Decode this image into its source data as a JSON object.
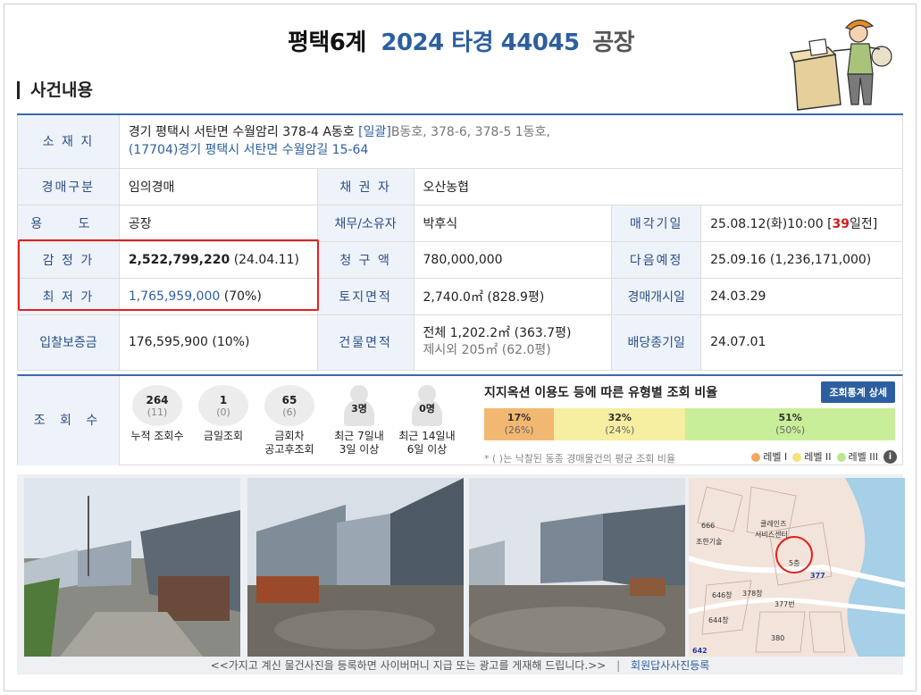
{
  "header": {
    "court": "평택6계",
    "case_no": "2024 타경 44045",
    "kind": "공장"
  },
  "section_title": "사건내용",
  "info": {
    "location_label": "소 재 지",
    "location_line1_a": "경기 평택시 서탄면 수월암리 378-4 A동호",
    "location_line1_b": "[일괄]",
    "location_line1_c": "B동호, 378-6, 378-5 1동호,",
    "location_line2_a": "(17704)경기 평택시 서탄면 수월암길 15-64",
    "auction_type_label": "경매구분",
    "auction_type": "임의경매",
    "creditor_label": "채 권 자",
    "creditor": "오산농협",
    "usage_label": "용 도",
    "usage": "공장",
    "owner_label": "채무/소유자",
    "owner": "박후식",
    "sale_date_label": "매각기일",
    "sale_date_a": "25.08.12(화)10:00 [",
    "sale_date_days": "39",
    "sale_date_b": "일전]",
    "appraisal_label": "감 정 가",
    "appraisal_value": "2,522,799,220",
    "appraisal_date": "(24.04.11)",
    "claim_label": "청 구 액",
    "claim": "780,000,000",
    "next_label": "다음예정",
    "next": "25.09.16 (1,236,171,000)",
    "min_label": "최 저 가",
    "min_value": "1,765,959,000",
    "min_pct": "(70%)",
    "land_label": "토지면적",
    "land": "2,740.0㎡ (828.9평)",
    "start_label": "경매개시일",
    "start": "24.03.29",
    "deposit_label": "입찰보증금",
    "deposit": "176,595,900 (10%)",
    "building_label": "건물면적",
    "building_line1": "전체 1,202.2㎡ (363.7평)",
    "building_line2": "제시외 205㎡ (62.0평)",
    "dividend_label": "배당종기일",
    "dividend": "24.07.01"
  },
  "views": {
    "label": "조 회 수",
    "stats": [
      {
        "n": "264",
        "s": "(11)",
        "cap1": "누적 조회수",
        "cap2": ""
      },
      {
        "n": "1",
        "s": "(0)",
        "cap1": "금일조회",
        "cap2": ""
      },
      {
        "n": "65",
        "s": "(6)",
        "cap1": "금회차",
        "cap2": "공고후조회"
      },
      {
        "n": "3명",
        "s": "",
        "cap1": "최근 7일내",
        "cap2": "3일 이상"
      },
      {
        "n": "0명",
        "s": "",
        "cap1": "최근 14일내",
        "cap2": "6일 이상"
      }
    ],
    "ratio_title": "지지옥션 이용도 등에 따른 유형별 조회 비율",
    "ratio_button": "조회통계 상세",
    "segments": [
      {
        "p": "17%",
        "q": "(26%)",
        "color": "#f2b872",
        "fraction": 0.17
      },
      {
        "p": "32%",
        "q": "(24%)",
        "color": "#f6eea0",
        "fraction": 0.32
      },
      {
        "p": "51%",
        "q": "(50%)",
        "color": "#c9ee9a",
        "fraction": 0.51
      }
    ],
    "note": "* ( )는 낙찰된 동종 경매물건의 평균 조회 비율",
    "legend": [
      "레벨 I",
      "레벨 II",
      "레벨 III"
    ],
    "legend_colors": [
      "#f2a95e",
      "#f6e27a",
      "#b8e88a"
    ],
    "info_icon": "i"
  },
  "footer": {
    "text": "<<가지고 계신 물건사진을 등록하면 사이버머니 지급 또는 광고를 게재해 드립니다.>>",
    "sep": "|",
    "link": "회원답사사진등록"
  },
  "map_labels": [
    "666",
    "클레인즈",
    "서비스센터",
    "377",
    "5층",
    "조한기술",
    "646창",
    "378창",
    "644창",
    "377번",
    "380",
    "642"
  ]
}
